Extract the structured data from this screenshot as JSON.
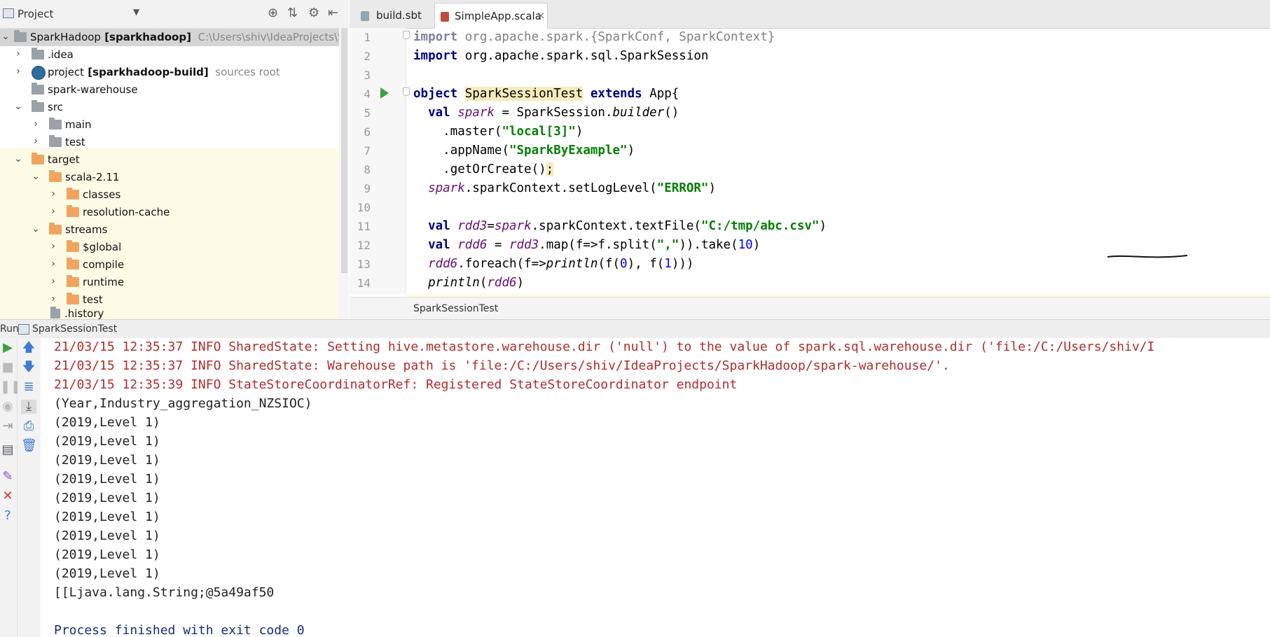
{
  "project_panel": {
    "title": "Project",
    "tree": [
      {
        "label": "SparkHadoop",
        "bold_suffix": " [sparkhadoop]",
        "hint": "C:\\Users\\shiv\\IdeaProjects\\SparkHado"
      },
      {
        "label": ".idea"
      },
      {
        "label": "project",
        "bold_suffix": " [sparkhadoop-build]",
        "hint": "sources root"
      },
      {
        "label": "spark-warehouse"
      },
      {
        "label": "src"
      },
      {
        "label": "main"
      },
      {
        "label": "test"
      },
      {
        "label": "target"
      },
      {
        "label": "scala-2.11"
      },
      {
        "label": "classes"
      },
      {
        "label": "resolution-cache"
      },
      {
        "label": "streams"
      },
      {
        "label": "$global"
      },
      {
        "label": "compile"
      },
      {
        "label": "runtime"
      },
      {
        "label": "test"
      },
      {
        "label": ".history"
      }
    ]
  },
  "editor": {
    "tabs": [
      {
        "label": "build.sbt",
        "close": "×"
      },
      {
        "label": "SimpleApp.scala",
        "close": "×"
      }
    ],
    "line_numbers": [
      "1",
      "2",
      "3",
      "4",
      "5",
      "6",
      "7",
      "8",
      "9",
      "10",
      "11",
      "12",
      "13",
      "14"
    ],
    "code": {
      "l1_a": "import",
      "l1_b": " org.apache.spark.{SparkConf, SparkContext}",
      "l2_a": "import",
      "l2_b": " org.apache.spark.sql.SparkSession",
      "l4_a": "object",
      "l4_b": "SparkSessionTest",
      "l4_c": "extends",
      "l4_d": " App{",
      "l5_a": "val",
      "l5_b": "spark",
      "l5_c": " = SparkSession.",
      "l5_d": "builder",
      "l5_e": "()",
      "l6_a": ".master(",
      "l6_b": "\"local[3]\"",
      "l6_c": ")",
      "l7_a": ".appName(",
      "l7_b": "\"SparkByExample\"",
      "l7_c": ")",
      "l8_a": ".getOrCreate()",
      "l8_b": ";",
      "l9_a": "spark",
      "l9_b": ".sparkContext.setLogLevel(",
      "l9_c": "\"ERROR\"",
      "l9_d": ")",
      "l11_a": "val",
      "l11_b": "rdd3",
      "l11_c": "=",
      "l11_d": "spark",
      "l11_e": ".sparkContext.textFile(",
      "l11_f": "\"C:/tmp/abc.csv\"",
      "l11_g": ")",
      "l12_a": "val",
      "l12_b": "rdd6",
      "l12_c": " = ",
      "l12_d": "rdd3",
      "l12_e": ".map(f=>f.split(",
      "l12_f": "\",\"",
      "l12_g": ")).take(",
      "l12_h": "10",
      "l12_i": ")",
      "l13_a": "rdd6",
      "l13_b": ".foreach(f=>",
      "l13_c": "println",
      "l13_d": "(f(",
      "l13_e": "0",
      "l13_f": "), f(",
      "l13_g": "1",
      "l13_h": ")))",
      "l14_a": "println",
      "l14_b": "(",
      "l14_c": "rdd6",
      "l14_d": ")"
    },
    "breadcrumb": "SparkSessionTest"
  },
  "run_panel": {
    "label": "Run",
    "tab": "SparkSessionTest",
    "console": [
      {
        "text": "21/03/15 12:35:37 INFO SharedState: Setting hive.metastore.warehouse.dir ('null') to the value of spark.sql.warehouse.dir ('file:/C:/Users/shiv/I",
        "kind": "err"
      },
      {
        "text": "21/03/15 12:35:37 INFO SharedState: Warehouse path is 'file:/C:/Users/shiv/IdeaProjects/SparkHadoop/spark-warehouse/'.",
        "kind": "err"
      },
      {
        "text": "21/03/15 12:35:39 INFO StateStoreCoordinatorRef: Registered StateStoreCoordinator endpoint",
        "kind": "err"
      },
      {
        "text": "(Year,Industry_aggregation_NZSIOC)",
        "kind": "out"
      },
      {
        "text": "(2019,Level 1)",
        "kind": "out"
      },
      {
        "text": "(2019,Level 1)",
        "kind": "out"
      },
      {
        "text": "(2019,Level 1)",
        "kind": "out"
      },
      {
        "text": "(2019,Level 1)",
        "kind": "out"
      },
      {
        "text": "(2019,Level 1)",
        "kind": "out"
      },
      {
        "text": "(2019,Level 1)",
        "kind": "out"
      },
      {
        "text": "(2019,Level 1)",
        "kind": "out"
      },
      {
        "text": "(2019,Level 1)",
        "kind": "out"
      },
      {
        "text": "(2019,Level 1)",
        "kind": "out"
      },
      {
        "text": "[[Ljava.lang.String;@5a49af50",
        "kind": "out"
      },
      {
        "text": "",
        "kind": "out"
      },
      {
        "text": "Process finished with exit code 0",
        "kind": "fin"
      }
    ]
  }
}
